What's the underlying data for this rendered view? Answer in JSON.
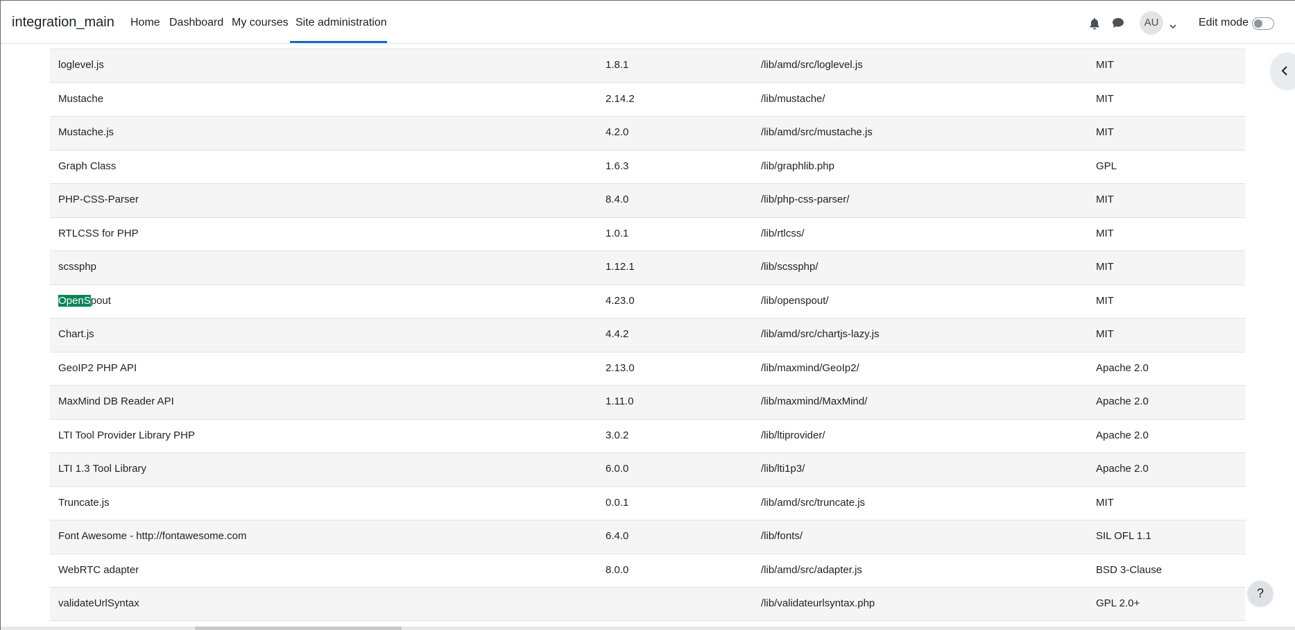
{
  "navbar": {
    "brand": "integration_main",
    "links": [
      "Home",
      "Dashboard",
      "My courses",
      "Site administration"
    ],
    "active_link": "Site administration",
    "avatar_initials": "AU",
    "edit_mode_label": "Edit mode",
    "edit_mode_on": false,
    "icons": [
      "bell-icon",
      "chat-bubble-icon",
      "chevron-down-icon"
    ]
  },
  "drawer_toggle_icon": "chevron-left-icon",
  "help_label": "?",
  "highlight": {
    "row": 7,
    "text": "OpenS",
    "color": "#0b8454"
  },
  "libraries": {
    "rows": [
      {
        "name": "loglevel.js",
        "version": "1.8.1",
        "location": "/lib/amd/src/loglevel.js",
        "license": "MIT"
      },
      {
        "name": "Mustache",
        "version": "2.14.2",
        "location": "/lib/mustache/",
        "license": "MIT"
      },
      {
        "name": "Mustache.js",
        "version": "4.2.0",
        "location": "/lib/amd/src/mustache.js",
        "license": "MIT"
      },
      {
        "name": "Graph Class",
        "version": "1.6.3",
        "location": "/lib/graphlib.php",
        "license": "GPL"
      },
      {
        "name": "PHP-CSS-Parser",
        "version": "8.4.0",
        "location": "/lib/php-css-parser/",
        "license": "MIT"
      },
      {
        "name": "RTLCSS for PHP",
        "version": "1.0.1",
        "location": "/lib/rtlcss/",
        "license": "MIT"
      },
      {
        "name": "scssphp",
        "version": "1.12.1",
        "location": "/lib/scssphp/",
        "license": "MIT"
      },
      {
        "name": "OpenSpout",
        "name_highlight": "OpenS",
        "name_rest": "pout",
        "version": "4.23.0",
        "location": "/lib/openspout/",
        "license": "MIT"
      },
      {
        "name": "Chart.js",
        "version": "4.4.2",
        "location": "/lib/amd/src/chartjs-lazy.js",
        "license": "MIT"
      },
      {
        "name": "GeoIP2 PHP API",
        "version": "2.13.0",
        "location": "/lib/maxmind/GeoIp2/",
        "license": "Apache 2.0"
      },
      {
        "name": "MaxMind DB Reader API",
        "version": "1.11.0",
        "location": "/lib/maxmind/MaxMind/",
        "license": "Apache 2.0"
      },
      {
        "name": "LTI Tool Provider Library PHP",
        "version": "3.0.2",
        "location": "/lib/ltiprovider/",
        "license": "Apache 2.0"
      },
      {
        "name": "LTI 1.3 Tool Library",
        "version": "6.0.0",
        "location": "/lib/lti1p3/",
        "license": "Apache 2.0"
      },
      {
        "name": "Truncate.js",
        "version": "0.0.1",
        "location": "/lib/amd/src/truncate.js",
        "license": "MIT"
      },
      {
        "name": "Font Awesome - http://fontawesome.com",
        "version": "6.4.0",
        "location": "/lib/fonts/",
        "license": "SIL OFL 1.1"
      },
      {
        "name": "WebRTC adapter",
        "version": "8.0.0",
        "location": "/lib/amd/src/adapter.js",
        "license": "BSD 3-Clause"
      },
      {
        "name": "validateUrlSyntax",
        "version": "",
        "location": "/lib/validateurlsyntax.php",
        "license": "GPL 2.0+"
      }
    ]
  }
}
